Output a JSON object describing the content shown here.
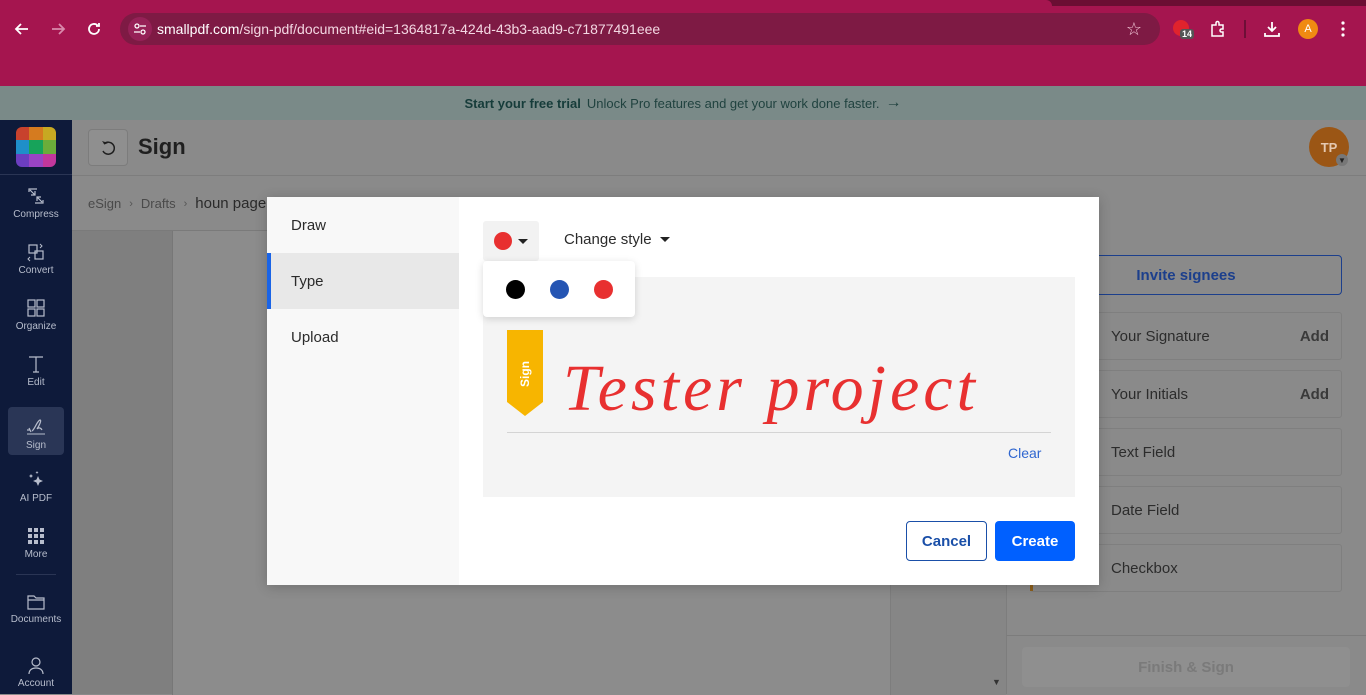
{
  "browser": {
    "url_host": "smallpdf.com",
    "url_path": "/sign-pdf/document#eid=1364817a-424d-43b3-aad9-c71877491eee",
    "extension_badge_count": "14",
    "profile_initial": "A"
  },
  "banner": {
    "bold_text": "Start your free trial",
    "text": "Unlock Pro features and get your work done faster.",
    "arrow": "→"
  },
  "leftnav": {
    "items": [
      {
        "label": "Compress",
        "icon": "compress-icon"
      },
      {
        "label": "Convert",
        "icon": "convert-icon"
      },
      {
        "label": "Organize",
        "icon": "organize-icon"
      },
      {
        "label": "Edit",
        "icon": "edit-icon"
      },
      {
        "label": "Sign",
        "icon": "sign-icon",
        "active": true
      },
      {
        "label": "AI PDF",
        "icon": "sparkle-icon"
      },
      {
        "label": "More",
        "icon": "grid-icon"
      },
      {
        "label": "Documents",
        "icon": "folder-icon"
      },
      {
        "label": "Account",
        "icon": "user-icon"
      }
    ]
  },
  "header": {
    "title": "Sign",
    "avatar_initials": "TP"
  },
  "breadcrumb": {
    "items": [
      "eSign",
      "Drafts",
      "houn page"
    ]
  },
  "right_panel": {
    "invite_label": "Invite signees",
    "fields": [
      {
        "label": "Your Signature",
        "action": "Add"
      },
      {
        "label": "Your Initials",
        "action": "Add"
      },
      {
        "label": "Text Field",
        "action": ""
      },
      {
        "label": "Date Field",
        "action": ""
      },
      {
        "label": "Checkbox",
        "action": ""
      }
    ],
    "finish_label": "Finish & Sign"
  },
  "modal": {
    "tabs": [
      {
        "label": "Draw",
        "active": false
      },
      {
        "label": "Type",
        "active": true
      },
      {
        "label": "Upload",
        "active": false
      }
    ],
    "selected_color": "#e83030",
    "change_style_label": "Change style",
    "color_options": [
      "#000000",
      "#2555b3",
      "#e83030"
    ],
    "ribbon_label": "Sign",
    "signature_text": "Tester project",
    "clear_label": "Clear",
    "cancel_label": "Cancel",
    "create_label": "Create"
  }
}
